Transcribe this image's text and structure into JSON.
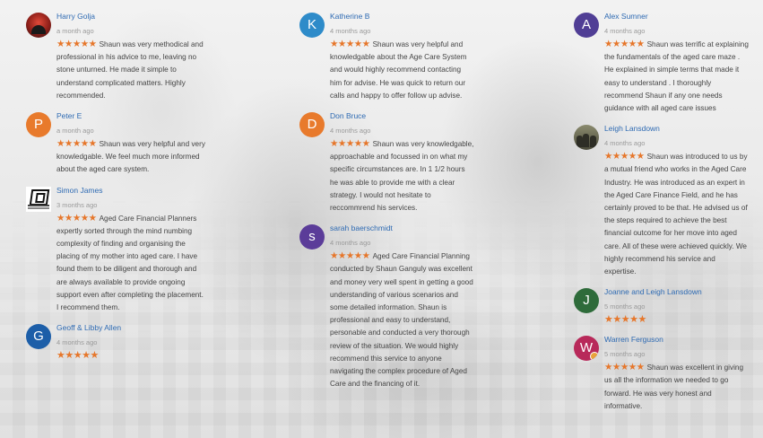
{
  "reviews": {
    "col1": [
      {
        "name": "Harry Golja",
        "date": "a month ago",
        "rating": 5,
        "avatar": "photo",
        "text": "Shaun was very methodical and professional in his advice to me, leaving no stone unturned. He made it simple to understand complicated matters. Highly recommended."
      },
      {
        "name": "Peter E",
        "date": "a month ago",
        "rating": 5,
        "avatar": "letter",
        "letter": "P",
        "color": "#e87a2c",
        "text": "Shaun was very helpful and very knowledgable. We feel much more informed about the aged care system."
      },
      {
        "name": "Simon James",
        "date": "3 months ago",
        "rating": 5,
        "avatar": "logo",
        "text": "Aged Care Financial Planners expertly sorted through the mind numbing complexity of finding and organising the placing of my mother into aged care. I have found them to be diligent and thorough and are always available to provide ongoing support even after completing the placement. I recommend them."
      },
      {
        "name": "Geoff & Libby Allen",
        "date": "4 months ago",
        "rating": 5,
        "avatar": "letter",
        "letter": "G",
        "color": "#1c5ea8",
        "text": ""
      }
    ],
    "col2": [
      {
        "name": "Katherine B",
        "date": "4 months ago",
        "rating": 5,
        "avatar": "letter",
        "letter": "K",
        "color": "#2e8bc9",
        "text": "Shaun was very helpful and knowledgable about the Age Care System and would highly recommend contacting him for advise. He was quick to return our calls and happy to offer follow up advise."
      },
      {
        "name": "Don Bruce",
        "date": "4 months ago",
        "rating": 5,
        "avatar": "letter",
        "letter": "D",
        "color": "#e87a2c",
        "text": "Shaun was very knowledgable, approachable and focussed in on what my specific circumstances are. In 1 1/2 hours he was able to provide me with a clear strategy. I would not hesitate to reccommrend his services."
      },
      {
        "name": "sarah baerschmidt",
        "date": "4 months ago",
        "rating": 5,
        "avatar": "letter",
        "letter": "s",
        "color": "#5b3c99",
        "text": "Aged Care Financial Planning conducted by Shaun Ganguly was excellent and money very well spent in getting a good understanding of various scenarios and some detailed information. Shaun is professional and easy to understand, personable and conducted a very thorough review of the situation. We would highly recommend this service to anyone navigating the complex procedure of Aged Care and the financing of it."
      }
    ],
    "col3": [
      {
        "name": "Alex Sumner",
        "date": "4 months ago",
        "rating": 5,
        "avatar": "letter",
        "letter": "A",
        "color": "#503e95",
        "text": "Shaun was terrific at explaining the fundamentals of the aged care maze . He explained in simple terms that made it easy to understand . I thoroughly recommend Shaun if any one needs guidance with all aged care issues"
      },
      {
        "name": "Leigh Lansdown",
        "date": "4 months ago",
        "rating": 5,
        "avatar": "group",
        "text": "Shaun was introduced to us by a mutual friend who works in the Aged Care Industry. He was introduced as an expert in the Aged Care Finance Field, and he has certainly proved to be that. He advised us of the steps required to achieve the best financial outcome for her move into aged care. All of these were achieved quickly. We highly recommend his service and expertise."
      },
      {
        "name": "Joanne and Leigh Lansdown",
        "date": "5 months ago",
        "rating": 5,
        "avatar": "letter",
        "letter": "J",
        "color": "#2e6b3a",
        "text": ""
      },
      {
        "name": "Warren Ferguson",
        "date": "5 months ago",
        "rating": 5,
        "avatar": "letter",
        "letter": "W",
        "color": "#b8295a",
        "badge": true,
        "text": "Shaun was excellent in giving us all the information we needed to go forward. He was very honest and informative."
      }
    ]
  },
  "star_glyphs": "★★★★★",
  "colors": {
    "name_link": "#2f6bb3",
    "stars": "#e6762a",
    "date": "#9a9a9a",
    "text": "#444444"
  }
}
